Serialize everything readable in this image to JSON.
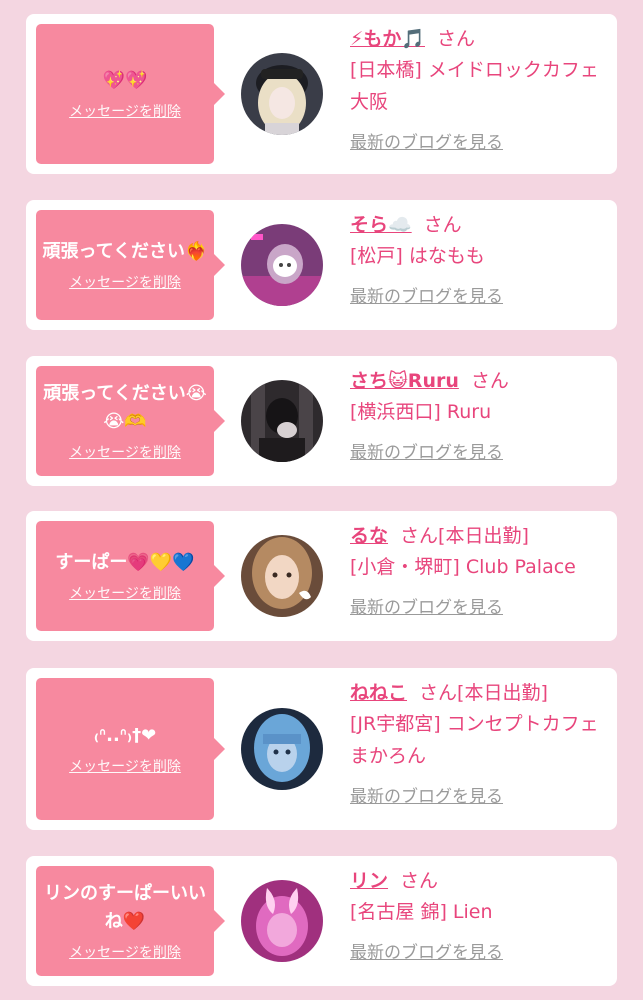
{
  "colors": {
    "bubble": "#f7899f",
    "accent": "#e8457c",
    "muted": "#9a9a9a",
    "background": "#f4d6e1"
  },
  "delete_label": "メッセージを削除",
  "san_label": "さん",
  "blog_label": "最新のブログを見る",
  "entries": [
    {
      "message": "💖💖",
      "name": "⚡もか🎵",
      "status": "",
      "shop": "[日本橋] メイドロックカフェ 大阪",
      "avatar": "girl-portrait-blonde"
    },
    {
      "message": "頑張ってください❤️‍🔥",
      "name": "そら☁️",
      "status": "",
      "shop": "[松戸] はなもも",
      "avatar": "girl-portrait-masked"
    },
    {
      "message": "頑張ってください😭😭🫶",
      "name": "さち😺Ruru",
      "status": "",
      "shop": "[横浜西口] Ruru",
      "avatar": "girl-portrait-dark"
    },
    {
      "message": "すーぱー💗💛💙",
      "name": "るな",
      "status": "[本日出勤]",
      "shop": "[小倉・堺町] Club Palace",
      "avatar": "girl-portrait-brown"
    },
    {
      "message": "₍ᐢ..ᐢ₎†❤",
      "name": "ねねこ",
      "status": "[本日出勤]",
      "shop": "[JR宇都宮] コンセプトカフェ まかろん",
      "avatar": "girl-portrait-blue"
    },
    {
      "message": "リンのすーぱーいいね❤️",
      "name": "リン",
      "status": "",
      "shop": "[名古屋 錦] Lien",
      "avatar": "girl-portrait-pink"
    }
  ]
}
